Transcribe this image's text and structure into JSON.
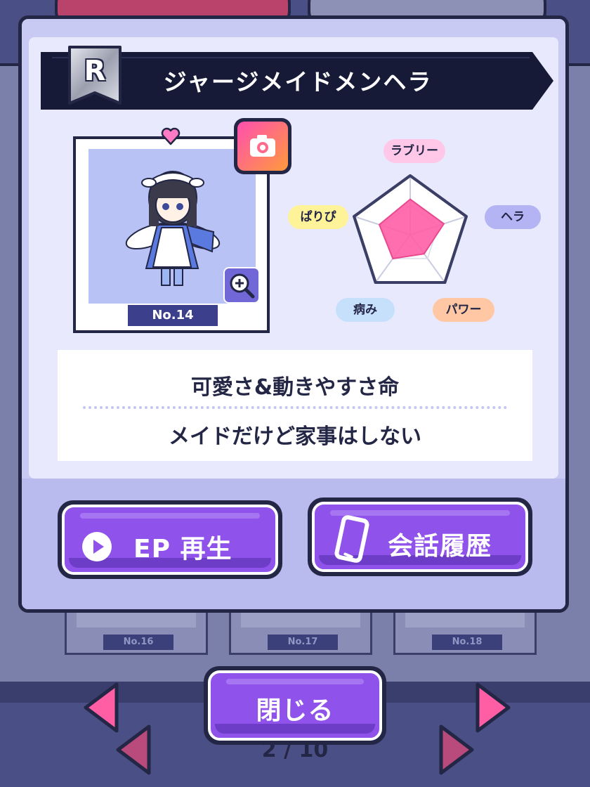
{
  "card": {
    "rarity": "R",
    "title": "ジャージメイドメンヘラ",
    "number": "No.14"
  },
  "stats": {
    "labels": {
      "lovely": "ラブリー",
      "hera": "ヘラ",
      "power": "パワー",
      "yami": "病み",
      "paripi": "ぱりぴ"
    },
    "values": {
      "lovely": 0.6,
      "hera": 0.6,
      "power": 0.4,
      "yami": 0.5,
      "paripi": 0.55
    },
    "colors": {
      "lovely": "#ffc8e8",
      "hera": "#b4b3f4",
      "power": "#ffc7a3",
      "yami": "#c6e0fb",
      "paripi": "#fff39a"
    }
  },
  "description": {
    "line1": "可愛さ&動きやすさ命",
    "line2": "メイドだけど家事はしない"
  },
  "buttons": {
    "episode": "EP 再生",
    "chat": "会話履歴",
    "close": "閉じる"
  },
  "background_cards": [
    "No.16",
    "No.17",
    "No.18"
  ],
  "pagination": "2 / 10",
  "colors": {
    "accent_purple": "#8f52ea",
    "navy": "#232645",
    "pink": "#ff5ea5"
  },
  "icons": {
    "camera": "camera-icon",
    "zoom": "zoom-in-icon",
    "play": "play-icon",
    "phone": "smartphone-icon",
    "heart": "heart-icon"
  }
}
